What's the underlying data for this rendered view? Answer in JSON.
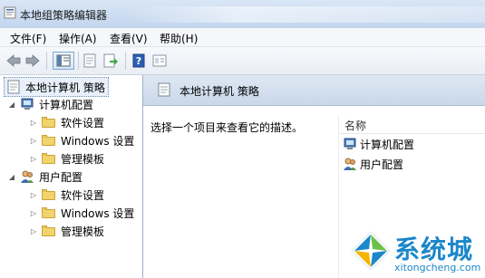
{
  "window": {
    "title": "本地组策略编辑器"
  },
  "menu": [
    "文件(F)",
    "操作(A)",
    "查看(V)",
    "帮助(H)"
  ],
  "toolbar": {
    "buttons": [
      "back-icon",
      "forward-icon",
      "show-tree-icon",
      "properties-icon",
      "export-icon",
      "help-icon",
      "view-icon"
    ]
  },
  "tree": {
    "root": "本地计算机 策略",
    "computer": {
      "label": "计算机配置",
      "children": [
        "软件设置",
        "Windows 设置",
        "管理模板"
      ]
    },
    "user": {
      "label": "用户配置",
      "children": [
        "软件设置",
        "Windows 设置",
        "管理模板"
      ]
    }
  },
  "details": {
    "title": "本地计算机 策略",
    "description": "选择一个项目来查看它的描述。",
    "column_name": "名称",
    "items": [
      "计算机配置",
      "用户配置"
    ]
  },
  "watermark": {
    "brand": "系统城",
    "url": "xitongcheng.com"
  },
  "colors": {
    "titlebar": "#c2d5ee",
    "accent": "#1c87c9",
    "folder": "#f3d36b"
  }
}
